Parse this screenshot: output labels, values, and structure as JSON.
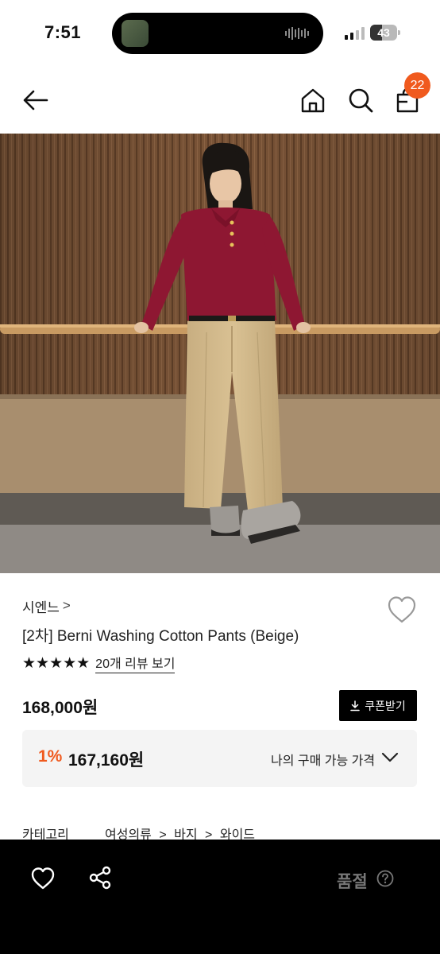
{
  "status_bar": {
    "time": "7:51",
    "battery_level": "43",
    "battery_percent": 43
  },
  "header": {
    "back_icon": "arrow-left-icon",
    "home_icon": "home-icon",
    "search_icon": "search-icon",
    "cart_icon": "shopping-bag-icon",
    "cart_badge": "22",
    "badge_color": "#f05a1e"
  },
  "product": {
    "brand": "시엔느",
    "brand_chevron": ">",
    "title": "[2차] Berni Washing Cotton Pants (Beige)",
    "rating": 5,
    "stars": "★★★★★",
    "review_link": "20개 리뷰 보기",
    "price": "168,000원",
    "coupon_button": "쿠폰받기",
    "wishlist_icon": "heart-outline-icon"
  },
  "member_price": {
    "rate": "1%",
    "price": "167,160원",
    "label": "나의 구매 가능 가격",
    "accent": "#f05a1e"
  },
  "category": {
    "label": "카테고리",
    "path": [
      "여성의류",
      "바지",
      "와이드"
    ],
    "separator": ">"
  },
  "bottom_bar": {
    "heart_icon": "heart-outline-icon",
    "share_icon": "share-icon",
    "status": "품절",
    "help_icon": "question-circle-icon"
  }
}
